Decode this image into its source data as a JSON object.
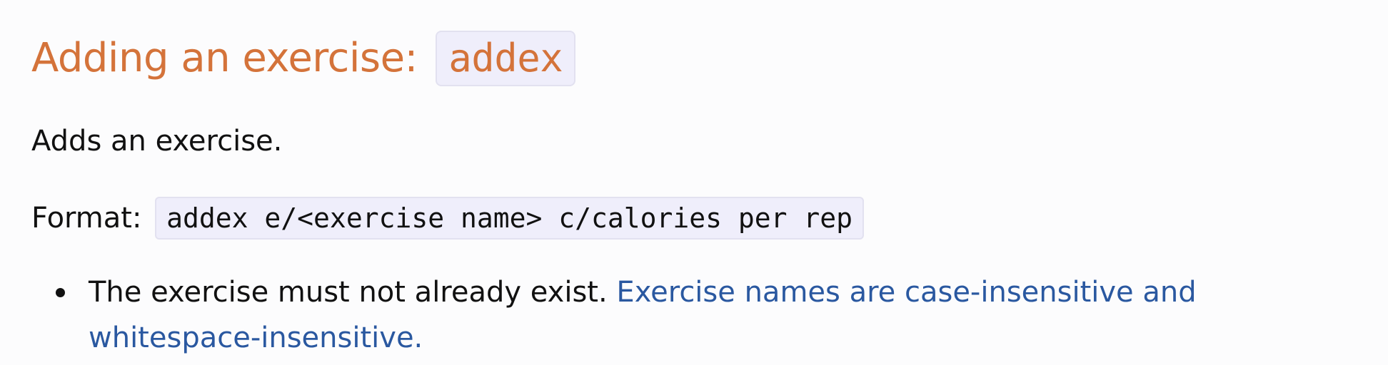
{
  "section": {
    "heading_text": "Adding an exercise: ",
    "heading_code": "addex"
  },
  "description": "Adds an exercise.",
  "format": {
    "label": "Format: ",
    "code": "addex e/<exercise name> c/calories per rep"
  },
  "bullets": [
    {
      "text": "The exercise must not already exist. ",
      "note": "Exercise names are case-insensitive and whitespace-insensitive."
    }
  ],
  "colors": {
    "heading": "#d4733a",
    "note": "#2a58a0",
    "code_background": "#efeefb"
  }
}
